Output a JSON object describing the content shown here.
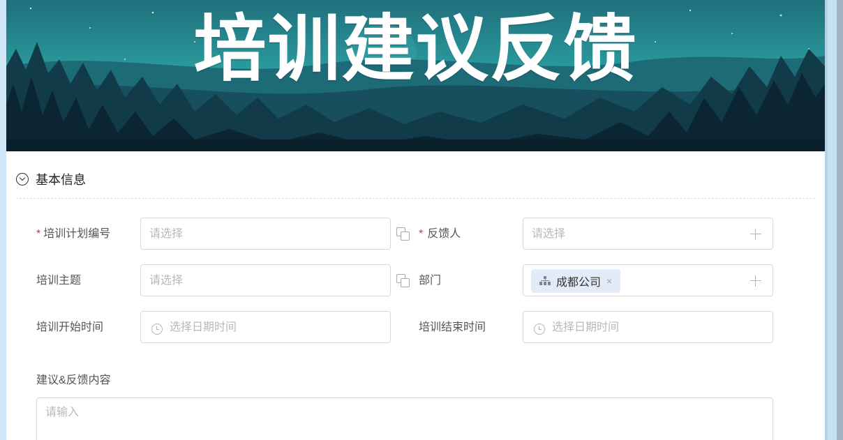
{
  "banner": {
    "title": "培训建议反馈"
  },
  "section": {
    "title": "基本信息"
  },
  "form": {
    "plan_no": {
      "label": "培训计划编号",
      "required_mark": "*",
      "placeholder": "请选择"
    },
    "feedbacker": {
      "label": "反馈人",
      "required_mark": "*",
      "placeholder": "请选择"
    },
    "topic": {
      "label": "培训主题",
      "placeholder": "请选择"
    },
    "department": {
      "label": "部门",
      "tag": "成都公司",
      "tag_close": "×"
    },
    "start_time": {
      "label": "培训开始时间",
      "placeholder": "选择日期时间"
    },
    "end_time": {
      "label": "培训结束时间",
      "placeholder": "选择日期时间"
    },
    "content": {
      "label": "建议&反馈内容",
      "placeholder": "请输入"
    }
  },
  "icons": [
    "chevron-down-circle-icon",
    "copy-icon",
    "plus-icon",
    "org-tree-icon",
    "clock-icon",
    "close-icon"
  ],
  "colors": {
    "required": "#e0302d",
    "tag_bg": "#e4ebf8",
    "banner_teal": "#2e9aa0",
    "banner_dark": "#0e2330"
  }
}
